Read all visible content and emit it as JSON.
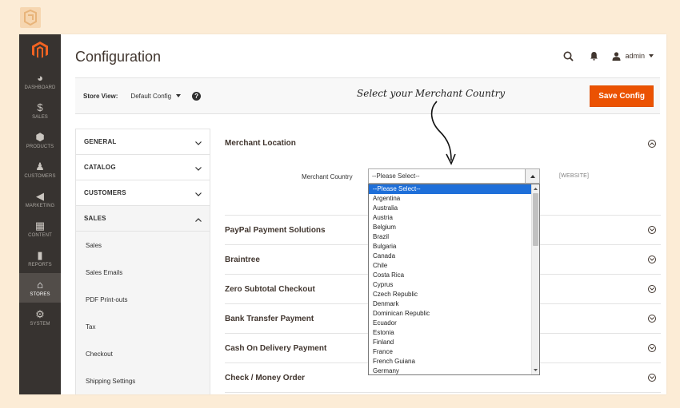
{
  "sidebar": {
    "items": [
      {
        "label": "DASHBOARD",
        "icon": "dashboard-icon",
        "glyph": "◕"
      },
      {
        "label": "SALES",
        "icon": "dollar-icon",
        "glyph": "$"
      },
      {
        "label": "PRODUCTS",
        "icon": "box-icon",
        "glyph": "⬢"
      },
      {
        "label": "CUSTOMERS",
        "icon": "person-icon",
        "glyph": "♟"
      },
      {
        "label": "MARKETING",
        "icon": "megaphone-icon",
        "glyph": "◀"
      },
      {
        "label": "CONTENT",
        "icon": "layout-icon",
        "glyph": "▦"
      },
      {
        "label": "REPORTS",
        "icon": "bar-chart-icon",
        "glyph": "▮"
      },
      {
        "label": "STORES",
        "icon": "store-icon",
        "glyph": "⌂"
      },
      {
        "label": "SYSTEM",
        "icon": "gear-icon",
        "glyph": "⚙"
      }
    ],
    "active": "STORES"
  },
  "header": {
    "title": "Configuration",
    "user": "admin"
  },
  "store_bar": {
    "label": "Store View:",
    "value": "Default Config",
    "help": "?",
    "annotation": "Select your Merchant Country",
    "save_label": "Save Config"
  },
  "tabs": {
    "items": [
      "GENERAL",
      "CATALOG",
      "CUSTOMERS",
      "SALES"
    ],
    "sales_sub": [
      "Sales",
      "Sales Emails",
      "PDF Print-outs",
      "Tax",
      "Checkout",
      "Shipping Settings"
    ]
  },
  "merchant": {
    "title": "Merchant Location",
    "field_label": "Merchant Country",
    "selected": "--Please Select--",
    "scope": "[WEBSITE]"
  },
  "sections": [
    "PayPal Payment Solutions",
    "Braintree",
    "Zero Subtotal Checkout",
    "Bank Transfer Payment",
    "Cash On Delivery Payment",
    "Check / Money Order"
  ],
  "country_options": [
    "--Please Select--",
    "Argentina",
    "Australia",
    "Austria",
    "Belgium",
    "Brazil",
    "Bulgaria",
    "Canada",
    "Chile",
    "Costa Rica",
    "Cyprus",
    "Czech Republic",
    "Denmark",
    "Dominican Republic",
    "Ecuador",
    "Estonia",
    "Finland",
    "France",
    "French Guiana",
    "Germany"
  ],
  "colors": {
    "accent": "#eb5202",
    "sidebar": "#373330",
    "highlight": "#1e6fd9",
    "background": "#fcecd6"
  }
}
